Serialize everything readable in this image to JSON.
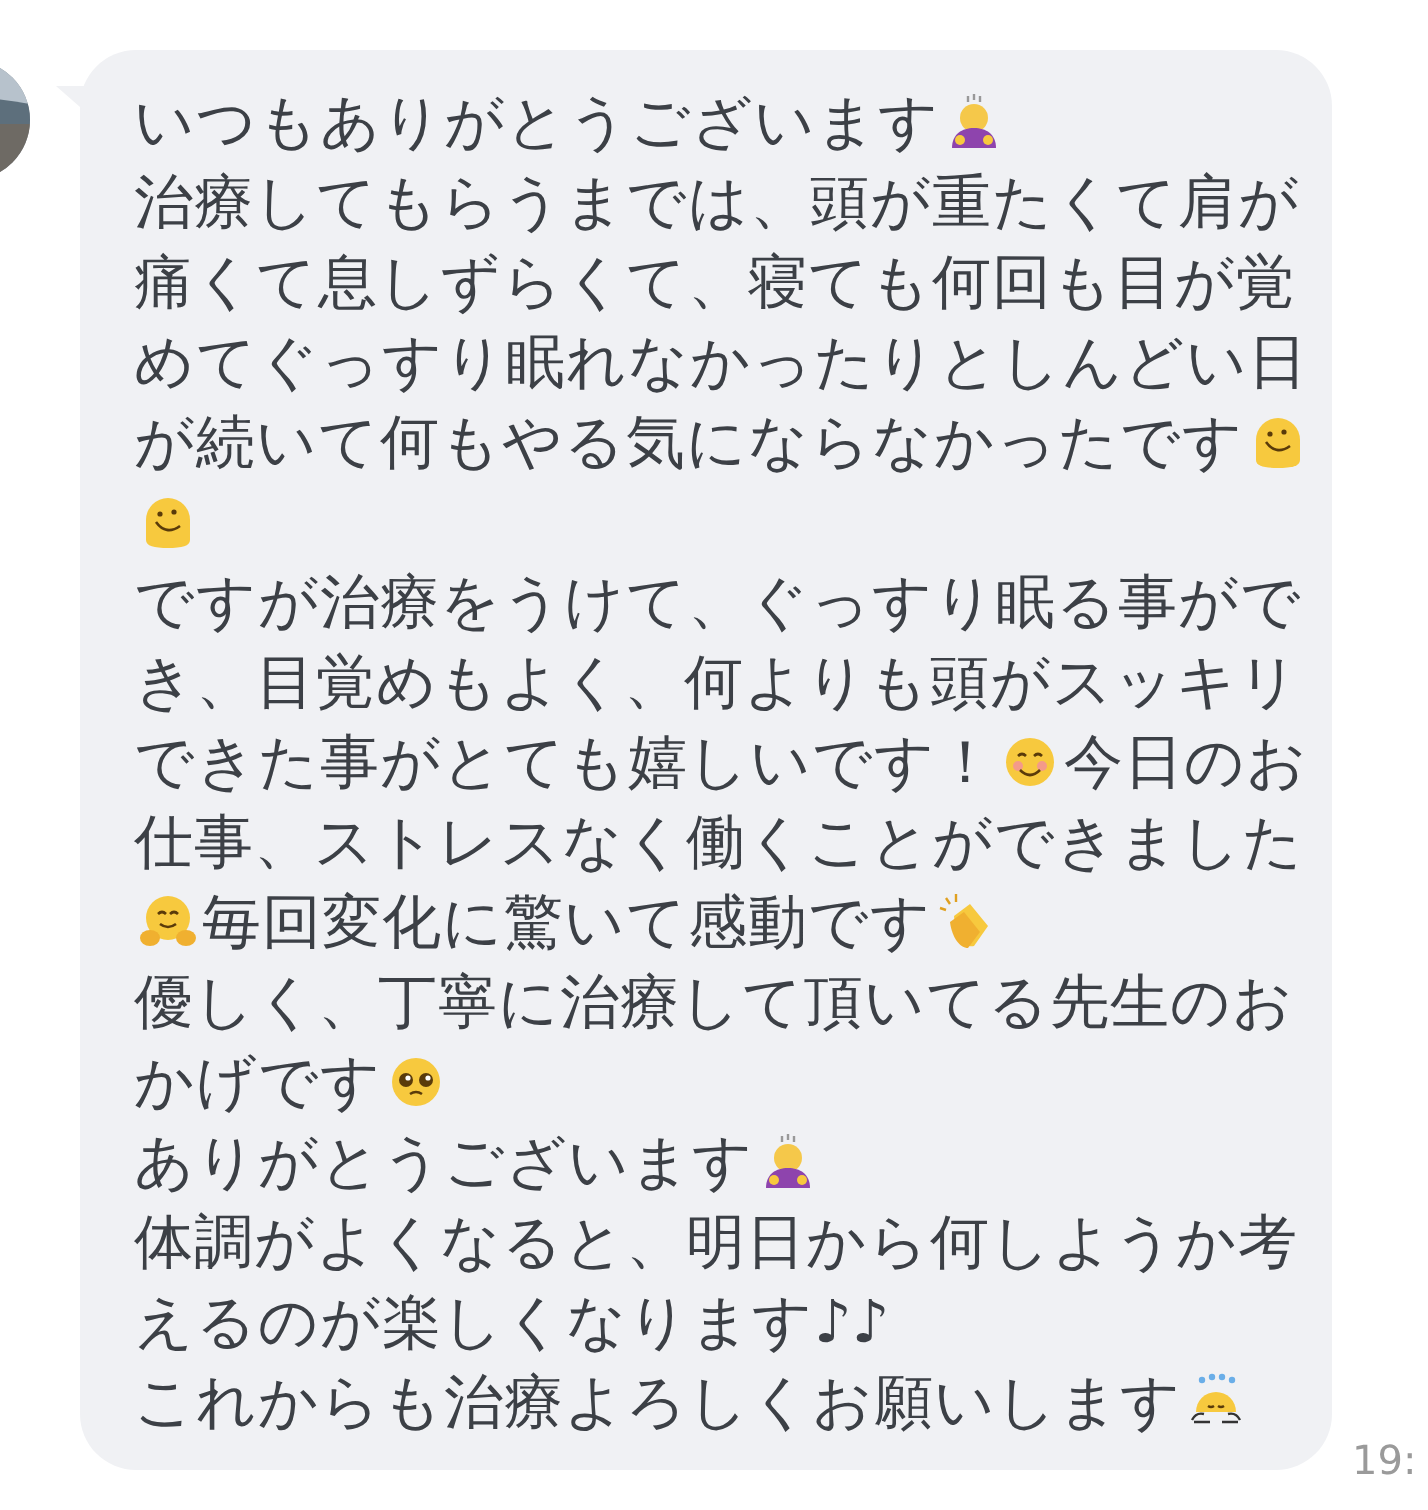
{
  "message": {
    "lines": [
      [
        {
          "kind": "text",
          "text": "いつもありがとうございます"
        },
        {
          "kind": "bow"
        }
      ],
      [
        {
          "kind": "text",
          "text": "治療してもらうまでは、頭が重たくて肩が"
        }
      ],
      [
        {
          "kind": "text",
          "text": "痛くて息しずらくて、寝ても何回も目が覚"
        }
      ],
      [
        {
          "kind": "text",
          "text": "めてぐっすり眠れなかったりとしんどい日"
        }
      ],
      [
        {
          "kind": "text",
          "text": "が続いて何もやる気にならなかったです"
        },
        {
          "kind": "melt"
        }
      ],
      [
        {
          "kind": "melt"
        }
      ],
      [
        {
          "kind": "text",
          "text": "ですが治療をうけて、ぐっすり眠る事がで"
        }
      ],
      [
        {
          "kind": "text",
          "text": "き、目覚めもよく、何よりも頭がスッキリ"
        }
      ],
      [
        {
          "kind": "text",
          "text": "できた事がとても嬉しいです！"
        },
        {
          "kind": "smile"
        },
        {
          "kind": "text",
          "text": "今日のお"
        }
      ],
      [
        {
          "kind": "text",
          "text": "仕事、ストレスなく働くことができました"
        }
      ],
      [
        {
          "kind": "hug"
        },
        {
          "kind": "text",
          "text": "毎回変化に驚いて感動です"
        },
        {
          "kind": "clap"
        }
      ],
      [
        {
          "kind": "text",
          "text": "優しく、丁寧に治療して頂いてる先生のお"
        }
      ],
      [
        {
          "kind": "text",
          "text": "かげです"
        },
        {
          "kind": "plead"
        }
      ],
      [
        {
          "kind": "text",
          "text": "ありがとうございます"
        },
        {
          "kind": "bow"
        }
      ],
      [
        {
          "kind": "text",
          "text": "体調がよくなると、明日から何しようか考"
        }
      ],
      [
        {
          "kind": "text",
          "text": "えるのが楽しくなります♪♪"
        }
      ],
      [
        {
          "kind": "text",
          "text": "これからも治療よろしくお願いします"
        },
        {
          "kind": "sweat-bow"
        }
      ]
    ],
    "time": "19:"
  }
}
